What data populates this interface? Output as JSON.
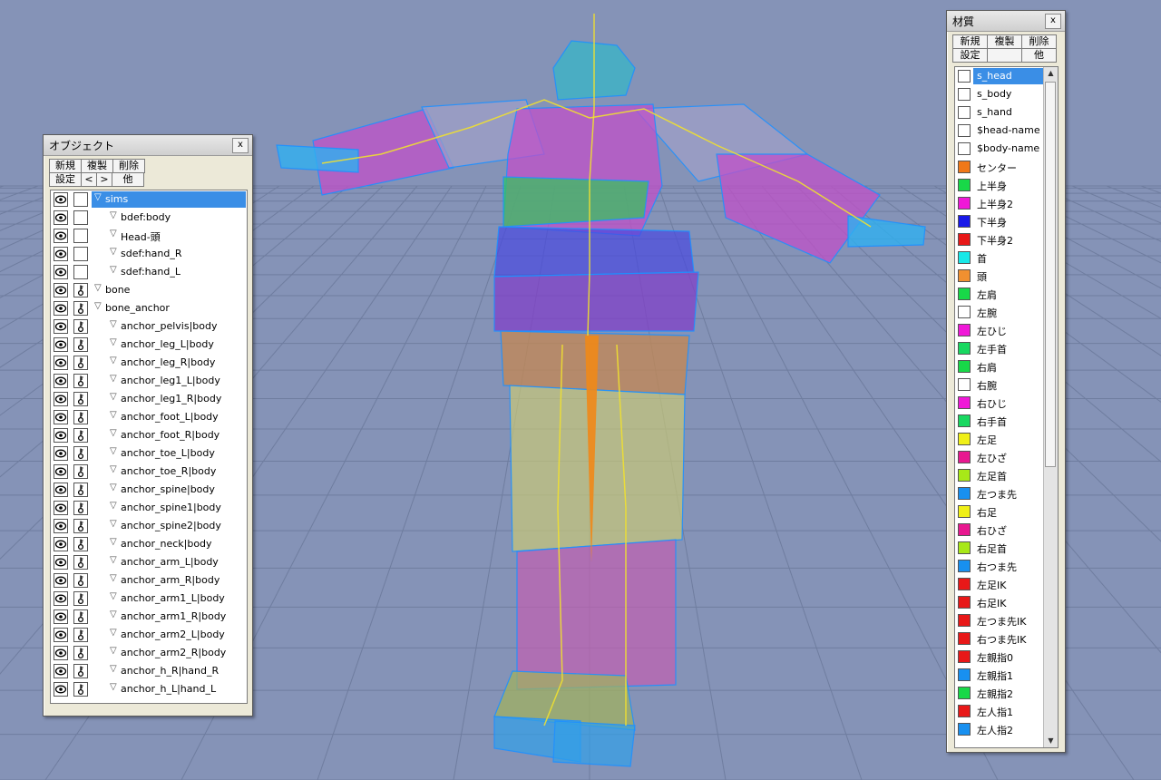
{
  "object_panel": {
    "title": "オブジェクト",
    "close": "x",
    "buttons_row1": [
      "新規",
      "複製",
      "削除"
    ],
    "buttons_row2": [
      "設定",
      "<",
      ">",
      "他"
    ],
    "items": [
      {
        "name": "sims",
        "depth": 0,
        "expander": true,
        "lock": false,
        "selected": true
      },
      {
        "name": "bdef:body",
        "depth": 1,
        "expander": true,
        "lock": false,
        "selected": false
      },
      {
        "name": "Head-頭",
        "depth": 1,
        "expander": true,
        "lock": false,
        "selected": false
      },
      {
        "name": "sdef:hand_R",
        "depth": 1,
        "expander": true,
        "lock": false,
        "selected": false
      },
      {
        "name": "sdef:hand_L",
        "depth": 1,
        "expander": true,
        "lock": false,
        "selected": false
      },
      {
        "name": "bone",
        "depth": 0,
        "expander": true,
        "lock": true,
        "selected": false
      },
      {
        "name": "bone_anchor",
        "depth": 0,
        "expander": true,
        "lock": true,
        "selected": false
      },
      {
        "name": "anchor_pelvis|body",
        "depth": 1,
        "expander": true,
        "lock": true,
        "selected": false
      },
      {
        "name": "anchor_leg_L|body",
        "depth": 1,
        "expander": true,
        "lock": true,
        "selected": false
      },
      {
        "name": "anchor_leg_R|body",
        "depth": 1,
        "expander": true,
        "lock": true,
        "selected": false
      },
      {
        "name": "anchor_leg1_L|body",
        "depth": 1,
        "expander": true,
        "lock": true,
        "selected": false
      },
      {
        "name": "anchor_leg1_R|body",
        "depth": 1,
        "expander": true,
        "lock": true,
        "selected": false
      },
      {
        "name": "anchor_foot_L|body",
        "depth": 1,
        "expander": true,
        "lock": true,
        "selected": false
      },
      {
        "name": "anchor_foot_R|body",
        "depth": 1,
        "expander": true,
        "lock": true,
        "selected": false
      },
      {
        "name": "anchor_toe_L|body",
        "depth": 1,
        "expander": true,
        "lock": true,
        "selected": false
      },
      {
        "name": "anchor_toe_R|body",
        "depth": 1,
        "expander": true,
        "lock": true,
        "selected": false
      },
      {
        "name": "anchor_spine|body",
        "depth": 1,
        "expander": true,
        "lock": true,
        "selected": false
      },
      {
        "name": "anchor_spine1|body",
        "depth": 1,
        "expander": true,
        "lock": true,
        "selected": false
      },
      {
        "name": "anchor_spine2|body",
        "depth": 1,
        "expander": true,
        "lock": true,
        "selected": false
      },
      {
        "name": "anchor_neck|body",
        "depth": 1,
        "expander": true,
        "lock": true,
        "selected": false
      },
      {
        "name": "anchor_arm_L|body",
        "depth": 1,
        "expander": true,
        "lock": true,
        "selected": false
      },
      {
        "name": "anchor_arm_R|body",
        "depth": 1,
        "expander": true,
        "lock": true,
        "selected": false
      },
      {
        "name": "anchor_arm1_L|body",
        "depth": 1,
        "expander": true,
        "lock": true,
        "selected": false
      },
      {
        "name": "anchor_arm1_R|body",
        "depth": 1,
        "expander": true,
        "lock": true,
        "selected": false
      },
      {
        "name": "anchor_arm2_L|body",
        "depth": 1,
        "expander": true,
        "lock": true,
        "selected": false
      },
      {
        "name": "anchor_arm2_R|body",
        "depth": 1,
        "expander": true,
        "lock": true,
        "selected": false
      },
      {
        "name": "anchor_h_R|hand_R",
        "depth": 1,
        "expander": true,
        "lock": true,
        "selected": false
      },
      {
        "name": "anchor_h_L|hand_L",
        "depth": 1,
        "expander": true,
        "lock": true,
        "selected": false
      }
    ]
  },
  "material_panel": {
    "title": "材質",
    "close": "x",
    "buttons_row1": [
      "新規",
      "複製",
      "削除"
    ],
    "buttons_row2": [
      "設定",
      "",
      "他"
    ],
    "items": [
      {
        "name": "s_head",
        "color": "#ffffff",
        "selected": true
      },
      {
        "name": "s_body",
        "color": "#ffffff",
        "selected": false
      },
      {
        "name": "s_hand",
        "color": "#ffffff",
        "selected": false
      },
      {
        "name": "$head-name",
        "color": "#ffffff",
        "selected": false
      },
      {
        "name": "$body-name",
        "color": "#ffffff",
        "selected": false
      },
      {
        "name": "センター",
        "color": "#f07818",
        "selected": false
      },
      {
        "name": "上半身",
        "color": "#18d848",
        "selected": false
      },
      {
        "name": "上半身2",
        "color": "#f018d8",
        "selected": false
      },
      {
        "name": "下半身",
        "color": "#1818e8",
        "selected": false
      },
      {
        "name": "下半身2",
        "color": "#e81818",
        "selected": false
      },
      {
        "name": "首",
        "color": "#18e8e8",
        "selected": false
      },
      {
        "name": "頭",
        "color": "#f09030",
        "selected": false
      },
      {
        "name": "左肩",
        "color": "#18d848",
        "selected": false
      },
      {
        "name": "左腕",
        "color": "#ffffff",
        "selected": false
      },
      {
        "name": "左ひじ",
        "color": "#f018d8",
        "selected": false
      },
      {
        "name": "左手首",
        "color": "#18d860",
        "selected": false
      },
      {
        "name": "右肩",
        "color": "#18d848",
        "selected": false
      },
      {
        "name": "右腕",
        "color": "#ffffff",
        "selected": false
      },
      {
        "name": "右ひじ",
        "color": "#f018d8",
        "selected": false
      },
      {
        "name": "右手首",
        "color": "#18d860",
        "selected": false
      },
      {
        "name": "左足",
        "color": "#f0f018",
        "selected": false
      },
      {
        "name": "左ひざ",
        "color": "#e81890",
        "selected": false
      },
      {
        "name": "左足首",
        "color": "#a8e818",
        "selected": false
      },
      {
        "name": "左つま先",
        "color": "#1890f0",
        "selected": false
      },
      {
        "name": "右足",
        "color": "#f0f018",
        "selected": false
      },
      {
        "name": "右ひざ",
        "color": "#e81890",
        "selected": false
      },
      {
        "name": "右足首",
        "color": "#a8e818",
        "selected": false
      },
      {
        "name": "右つま先",
        "color": "#1890f0",
        "selected": false
      },
      {
        "name": "左足IK",
        "color": "#e81818",
        "selected": false
      },
      {
        "name": "右足IK",
        "color": "#e81818",
        "selected": false
      },
      {
        "name": "左つま先IK",
        "color": "#e81818",
        "selected": false
      },
      {
        "name": "右つま先IK",
        "color": "#e81818",
        "selected": false
      },
      {
        "name": "左親指0",
        "color": "#e81818",
        "selected": false
      },
      {
        "name": "左親指1",
        "color": "#1890f0",
        "selected": false
      },
      {
        "name": "左親指2",
        "color": "#18d848",
        "selected": false
      },
      {
        "name": "左人指1",
        "color": "#e81818",
        "selected": false
      },
      {
        "name": "左人指2",
        "color": "#1890f0",
        "selected": false
      }
    ]
  }
}
